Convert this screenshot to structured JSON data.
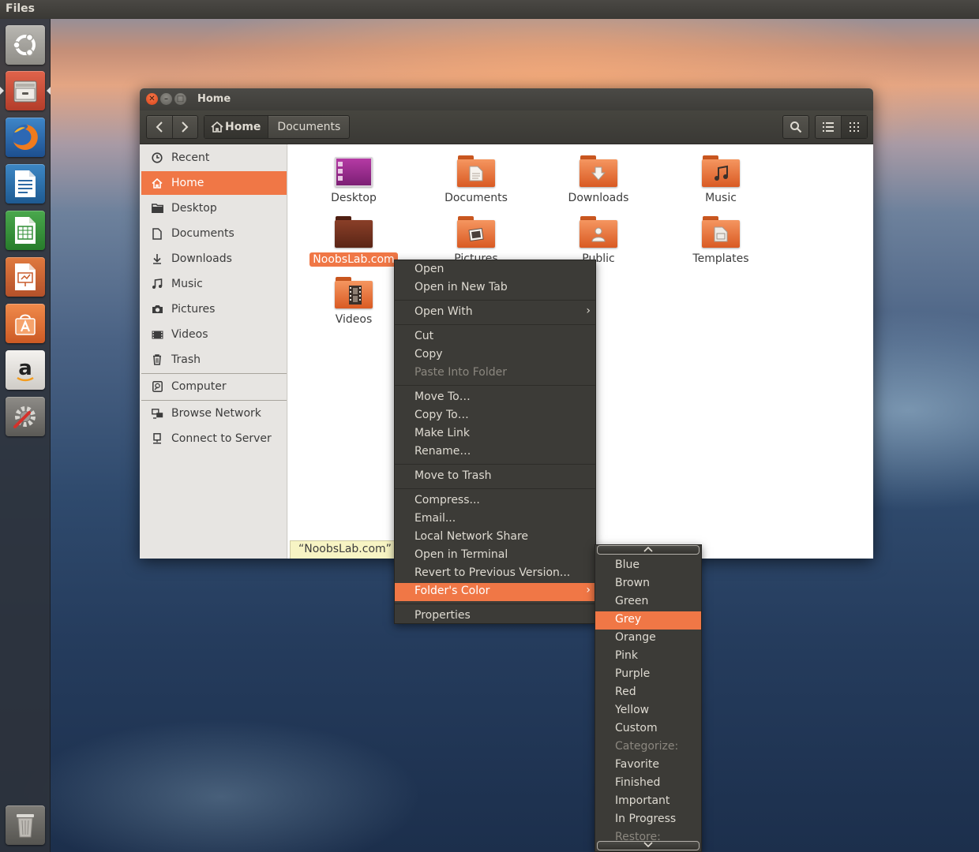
{
  "panel": {
    "title": "Files"
  },
  "window": {
    "title": "Home"
  },
  "toolbar": {
    "back": "<",
    "forward": ">",
    "path": {
      "home": "Home",
      "current": "Documents"
    }
  },
  "sidebar": {
    "items": [
      {
        "label": "Recent",
        "icon": "clock-icon"
      },
      {
        "label": "Home",
        "icon": "home-icon"
      },
      {
        "label": "Desktop",
        "icon": "folder-icon"
      },
      {
        "label": "Documents",
        "icon": "document-icon"
      },
      {
        "label": "Downloads",
        "icon": "download-icon"
      },
      {
        "label": "Music",
        "icon": "music-note-icon"
      },
      {
        "label": "Pictures",
        "icon": "camera-icon"
      },
      {
        "label": "Videos",
        "icon": "film-icon"
      },
      {
        "label": "Trash",
        "icon": "trash-icon"
      }
    ],
    "devices": [
      {
        "label": "Computer",
        "icon": "drive-icon"
      }
    ],
    "network": [
      {
        "label": "Browse Network",
        "icon": "network-icon"
      },
      {
        "label": "Connect to Server",
        "icon": "server-icon"
      }
    ]
  },
  "files": [
    {
      "label": "Desktop",
      "kind": "desktop"
    },
    {
      "label": "Documents",
      "kind": "documents"
    },
    {
      "label": "Downloads",
      "kind": "downloads"
    },
    {
      "label": "Music",
      "kind": "music"
    },
    {
      "label": "NoobsLab.com",
      "kind": "brown",
      "selected": true
    },
    {
      "label": "Pictures",
      "kind": "pictures"
    },
    {
      "label": "Public",
      "kind": "public"
    },
    {
      "label": "Templates",
      "kind": "templates"
    },
    {
      "label": "Videos",
      "kind": "videos"
    }
  ],
  "status": {
    "text": "“NoobsLab.com” s"
  },
  "context_menu": {
    "items": [
      {
        "label": "Open"
      },
      {
        "label": "Open in New Tab"
      },
      {
        "label": "Open With",
        "submenu": true
      },
      {
        "label": "Cut"
      },
      {
        "label": "Copy"
      },
      {
        "label": "Paste Into Folder",
        "disabled": true
      },
      {
        "label": "Move To…"
      },
      {
        "label": "Copy To…"
      },
      {
        "label": "Make Link"
      },
      {
        "label": "Rename…"
      },
      {
        "label": "Move to Trash"
      },
      {
        "label": "Compress..."
      },
      {
        "label": "Email..."
      },
      {
        "label": "Local Network Share"
      },
      {
        "label": "Open in Terminal"
      },
      {
        "label": "Revert to Previous Version..."
      },
      {
        "label": "Folder's Color",
        "submenu": true,
        "highlight": true
      },
      {
        "label": "Properties"
      }
    ]
  },
  "color_submenu": {
    "scroll_up": "^",
    "scroll_down": "v",
    "items": [
      {
        "label": "Blue"
      },
      {
        "label": "Brown"
      },
      {
        "label": "Green"
      },
      {
        "label": "Grey",
        "highlight": true
      },
      {
        "label": "Orange"
      },
      {
        "label": "Pink"
      },
      {
        "label": "Purple"
      },
      {
        "label": "Red"
      },
      {
        "label": "Yellow"
      },
      {
        "label": "Custom"
      },
      {
        "label": "Categorize:",
        "disabled": true
      },
      {
        "label": "Favorite"
      },
      {
        "label": "Finished"
      },
      {
        "label": "Important"
      },
      {
        "label": "In Progress"
      },
      {
        "label": "Restore:",
        "disabled": true
      }
    ]
  },
  "launcher": {
    "items": [
      {
        "name": "ubuntu-dash"
      },
      {
        "name": "files"
      },
      {
        "name": "firefox"
      },
      {
        "name": "libreoffice-writer"
      },
      {
        "name": "libreoffice-calc"
      },
      {
        "name": "libreoffice-impress"
      },
      {
        "name": "ubuntu-software-center"
      },
      {
        "name": "amazon",
        "glyph": "a"
      },
      {
        "name": "system-settings"
      },
      {
        "name": "trash"
      }
    ]
  },
  "colors": {
    "accent": "#f07746",
    "panel": "#3c3b37",
    "sidebar": "#e7e5e2",
    "folder_orange": "#e8733a",
    "folder_brown": "#6b2f1e"
  }
}
